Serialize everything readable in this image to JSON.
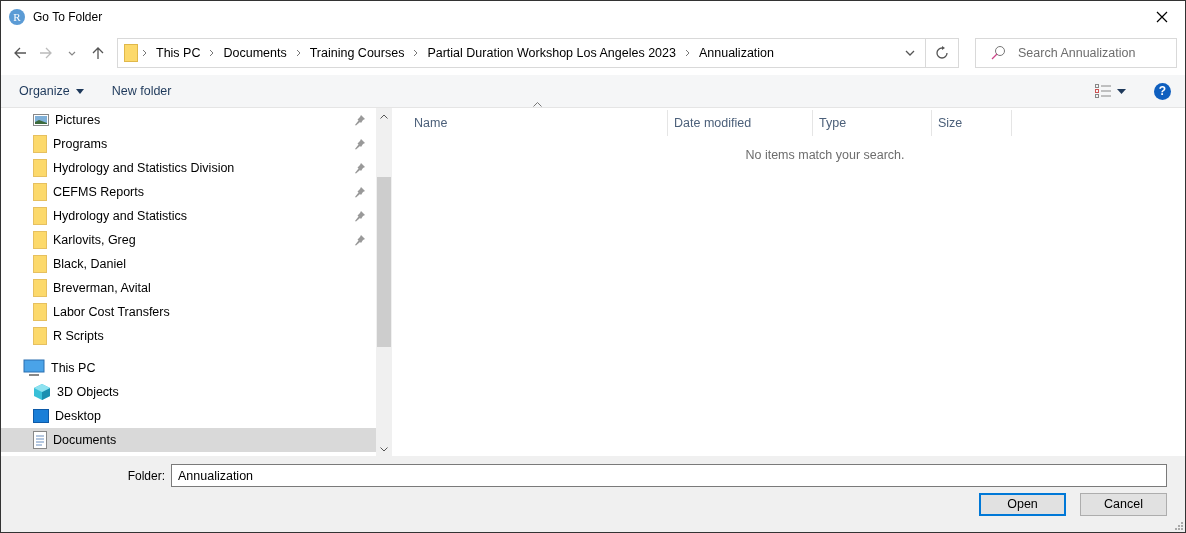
{
  "window": {
    "title": "Go To Folder",
    "app_icon_letter": "R"
  },
  "address_bar": {
    "crumbs": [
      "This PC",
      "Documents",
      "Training Courses",
      "Partial Duration Workshop Los Angeles 2023",
      "Annualization"
    ]
  },
  "search": {
    "placeholder": "Search Annualization"
  },
  "toolbar": {
    "organize": "Organize",
    "new_folder": "New folder",
    "help_glyph": "?"
  },
  "sidebar": {
    "items": [
      {
        "label": "Pictures",
        "kind": "pictures",
        "pinned": true,
        "selected": false
      },
      {
        "label": "Programs",
        "kind": "folder",
        "pinned": true,
        "selected": false
      },
      {
        "label": "Hydrology and Statistics Division",
        "kind": "folder",
        "pinned": true,
        "selected": false
      },
      {
        "label": "CEFMS Reports",
        "kind": "folder",
        "pinned": true,
        "selected": false
      },
      {
        "label": "Hydrology and Statistics",
        "kind": "folder",
        "pinned": true,
        "selected": false
      },
      {
        "label": "Karlovits, Greg",
        "kind": "folder",
        "pinned": true,
        "selected": false
      },
      {
        "label": "Black, Daniel",
        "kind": "folder",
        "pinned": false,
        "selected": false
      },
      {
        "label": "Breverman, Avital",
        "kind": "folder",
        "pinned": false,
        "selected": false
      },
      {
        "label": "Labor Cost Transfers",
        "kind": "folder",
        "pinned": false,
        "selected": false
      },
      {
        "label": "R Scripts",
        "kind": "folder",
        "pinned": false,
        "selected": false
      },
      {
        "label": "This PC",
        "kind": "pc",
        "pinned": false,
        "selected": false,
        "children": [
          {
            "label": "3D Objects",
            "kind": "objects3d",
            "pinned": false,
            "selected": false
          },
          {
            "label": "Desktop",
            "kind": "desktop",
            "pinned": false,
            "selected": false
          },
          {
            "label": "Documents",
            "kind": "documents",
            "pinned": false,
            "selected": true
          }
        ]
      }
    ]
  },
  "file_list": {
    "columns": [
      {
        "label": "Name",
        "sorted": true
      },
      {
        "label": "Date modified",
        "sorted": false
      },
      {
        "label": "Type",
        "sorted": false
      },
      {
        "label": "Size",
        "sorted": false
      }
    ],
    "empty_message": "No items match your search."
  },
  "footer": {
    "folder_label": "Folder:",
    "folder_value": "Annualization",
    "buttons": [
      {
        "label": "Open",
        "default": true
      },
      {
        "label": "Cancel",
        "default": false
      }
    ]
  }
}
